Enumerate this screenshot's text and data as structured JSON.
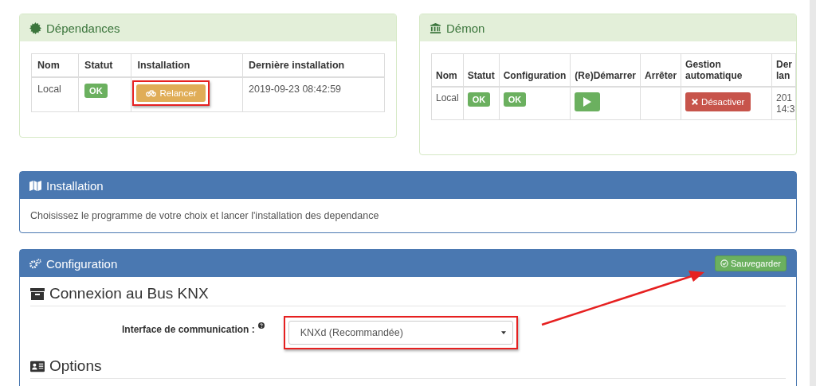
{
  "dependencies": {
    "title": "Dépendances",
    "columns": [
      "Nom",
      "Statut",
      "Installation",
      "Dernière installation"
    ],
    "row": {
      "name": "Local",
      "status": "OK",
      "action": "Relancer",
      "last": "2019-09-23 08:42:59"
    }
  },
  "daemon": {
    "title": "Démon",
    "columns": [
      "Nom",
      "Statut",
      "Configuration",
      "(Re)Démarrer",
      "Arrêter",
      "Gestion automatique",
      "Der lan"
    ],
    "row": {
      "name": "Local",
      "status": "OK",
      "config": "OK",
      "auto": "Désactiver",
      "last": "201 14:3"
    }
  },
  "installation": {
    "title": "Installation",
    "text": "Choisissez le programme de votre choix et lancer l'installation des dependance"
  },
  "configuration": {
    "title": "Configuration",
    "save": "Sauvegarder",
    "section": "Connexion au Bus KNX",
    "field_label": "Interface de communication :",
    "field_value": "KNXd (Recommandée)",
    "options_title": "Options"
  }
}
